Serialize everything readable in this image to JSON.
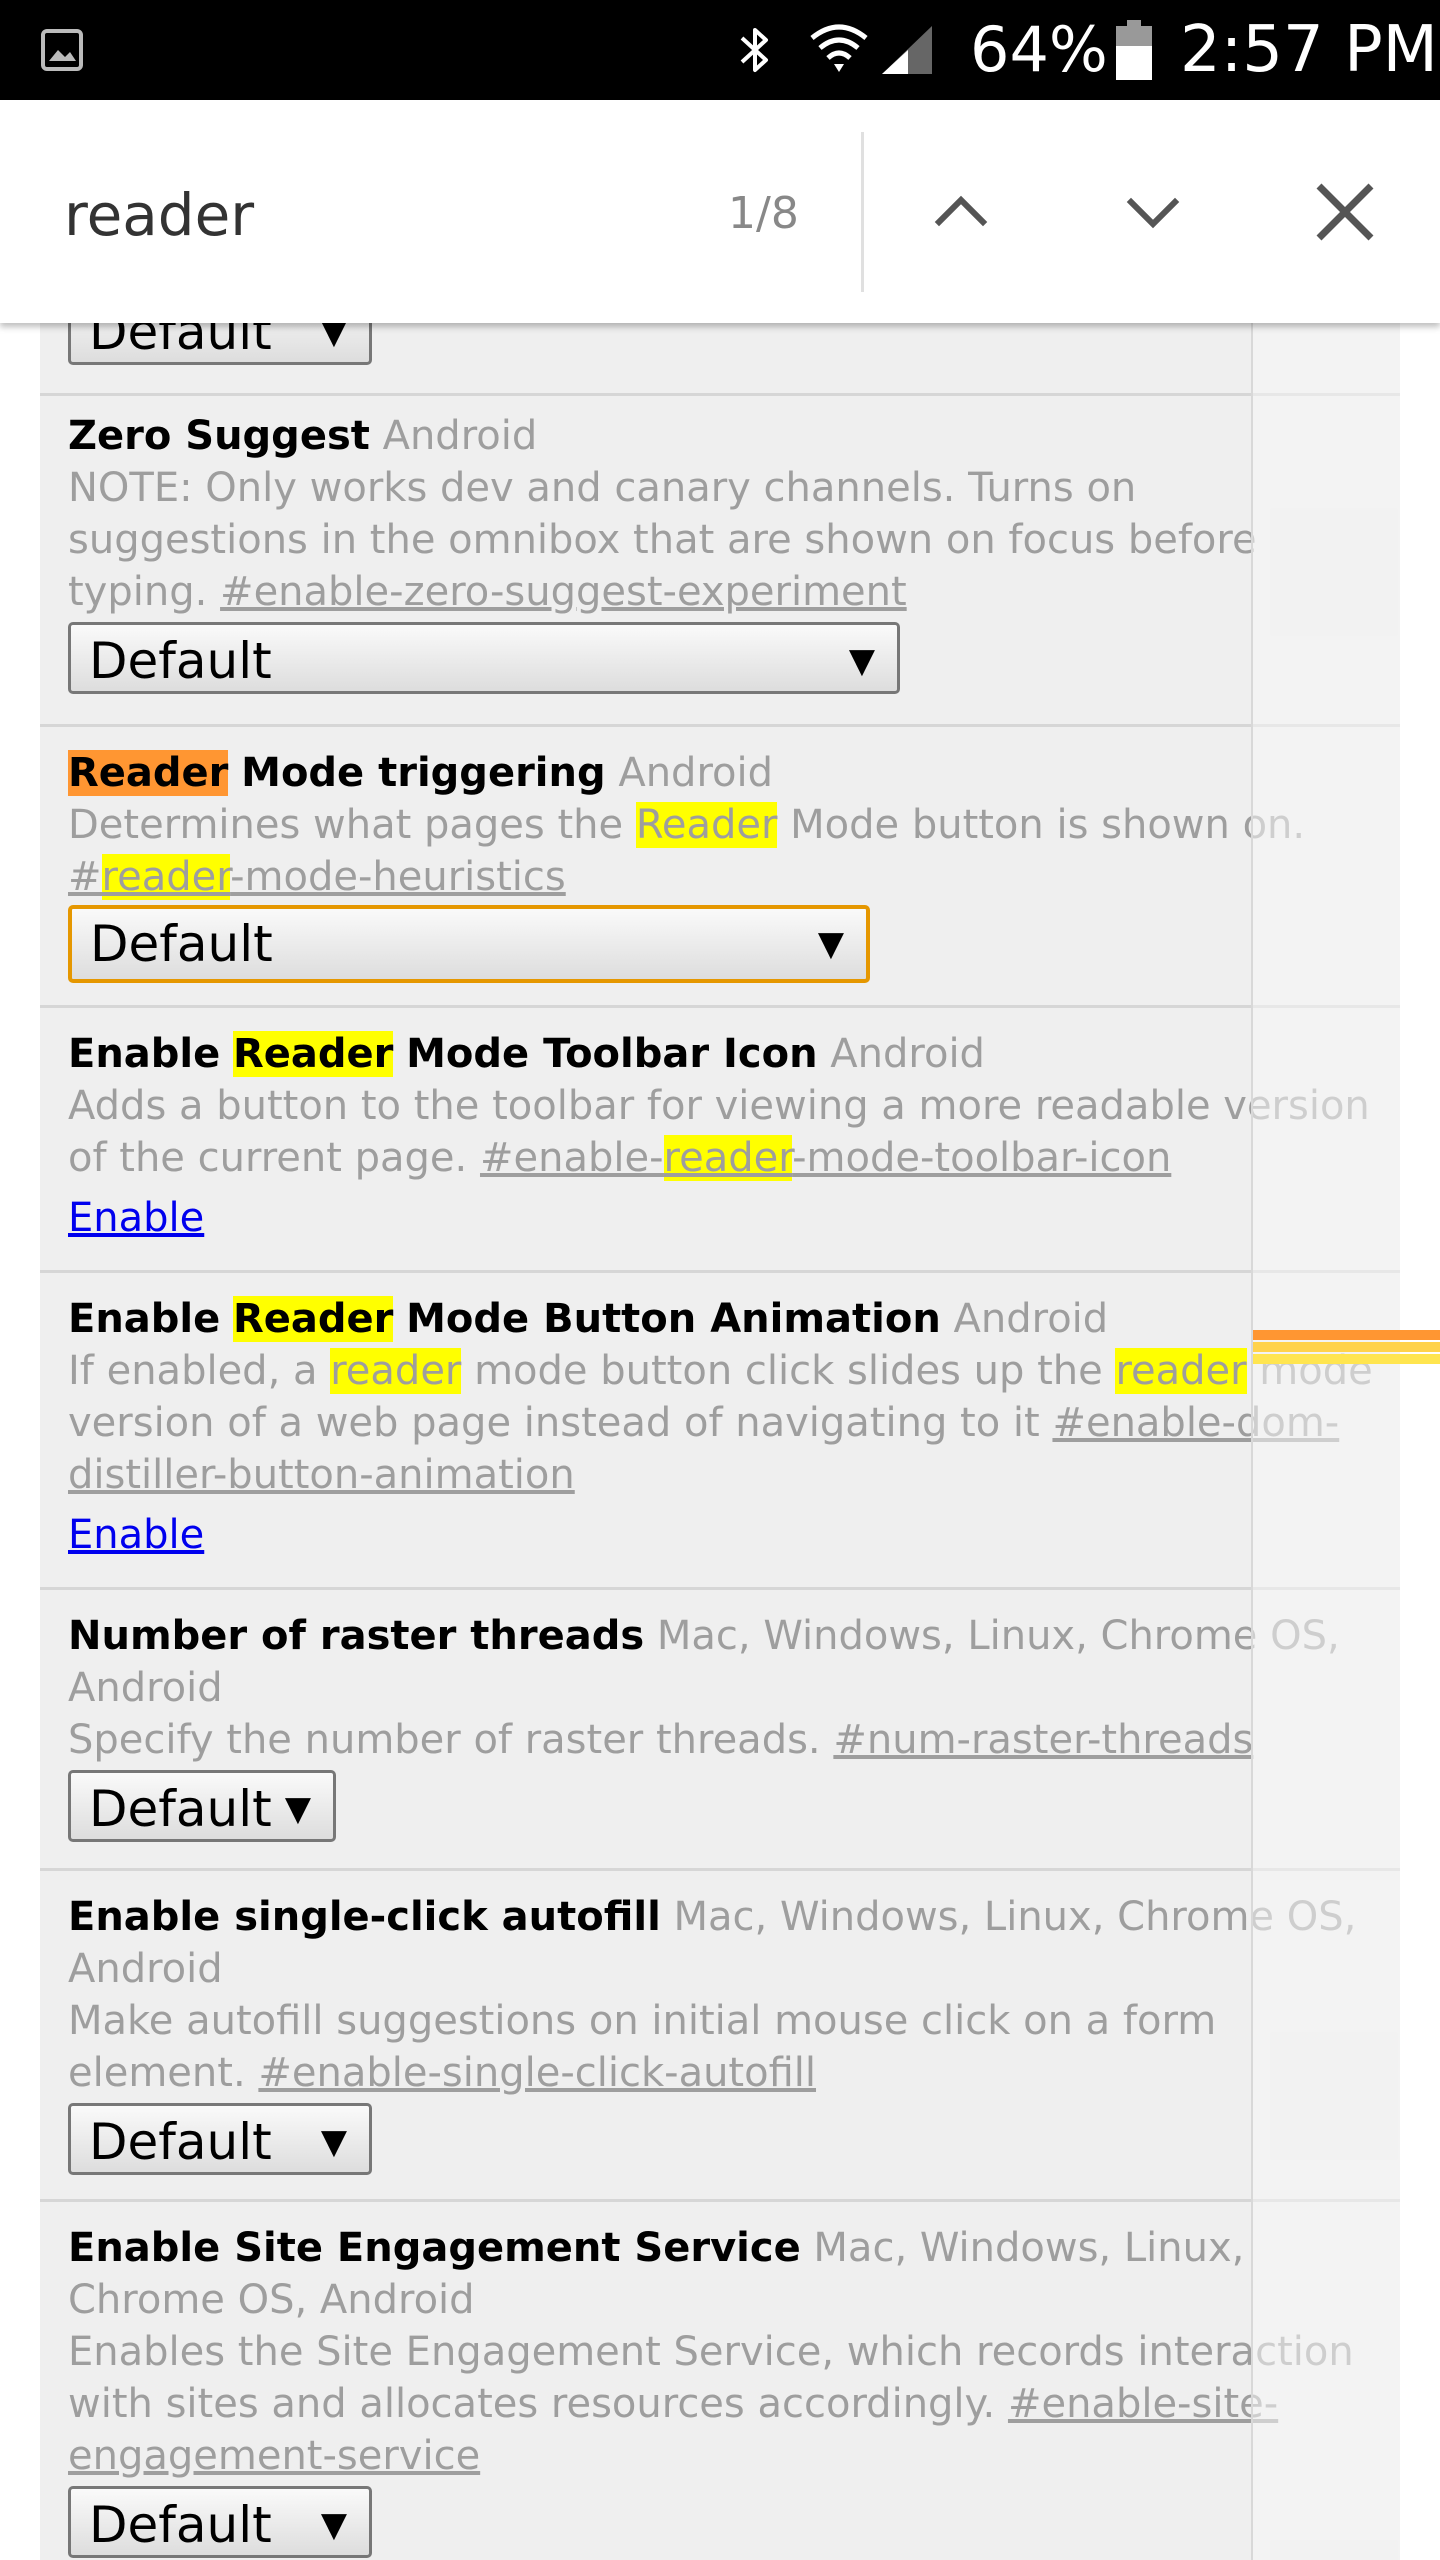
{
  "status_bar": {
    "battery": "64%",
    "time": "2:57 PM",
    "icons": [
      "gallery-icon",
      "bluetooth-icon",
      "wifi-icon",
      "signal-icon",
      "battery-icon"
    ]
  },
  "find_bar": {
    "query": "reader",
    "match_count": "1/8",
    "buttons": [
      "previous-match",
      "next-match",
      "close"
    ]
  },
  "colors": {
    "highlight": "#ffff00",
    "active_highlight": "#ff9632",
    "link": "#0000ee",
    "muted": "#9e9e9e",
    "focus_border": "#e59700"
  },
  "flags": [
    {
      "select_value": "Default"
    },
    {
      "title": "Zero Suggest",
      "platforms": "Android",
      "description": "NOTE: Only works dev and canary channels. Turns on suggestions in the omnibox that are shown on focus before typing.",
      "hashtag": "#enable-zero-suggest-experiment",
      "select_value": "Default"
    },
    {
      "title_highlight": "Reader",
      "title_rest": "Mode triggering",
      "platforms": "Android",
      "description_before": "Determines what pages the",
      "description_highlight": "Reader",
      "description_after": "Mode button is shown on.",
      "hashtag_before": "#",
      "hashtag_highlight": "reader",
      "hashtag_after": "-mode-heuristics",
      "select_value": "Default"
    },
    {
      "title_before": "Enable",
      "title_highlight": "Reader",
      "title_after": "Mode Toolbar Icon",
      "platforms": "Android",
      "description": "Adds a button to the toolbar for viewing a more readable version of the current page.",
      "hashtag_before": "#enable-",
      "hashtag_highlight": "reader",
      "hashtag_after": "-mode-toolbar-icon",
      "action": "Enable"
    },
    {
      "title_before": "Enable",
      "title_highlight": "Reader",
      "title_after": "Mode Button Animation",
      "platforms": "Android",
      "description_1": "If enabled, a",
      "description_hl_1": "reader",
      "description_2": "mode button click slides up the",
      "description_hl_2": "reader",
      "description_3": "mode version of a web page instead of navigating to it",
      "hashtag": "#enable-dom-distiller-button-animation",
      "action": "Enable"
    },
    {
      "title": "Number of raster threads",
      "platforms": "Mac, Windows, Linux, Chrome OS, Android",
      "description": "Specify the number of raster threads.",
      "hashtag": "#num-raster-threads",
      "select_value": "Default"
    },
    {
      "title": "Enable single-click autofill",
      "platforms": "Mac, Windows, Linux, Chrome OS, Android",
      "description": "Make autofill suggestions on initial mouse click on a form element.",
      "hashtag": "#enable-single-click-autofill",
      "select_value": "Default"
    },
    {
      "title": "Enable Site Engagement Service",
      "platforms": "Mac, Windows, Linux, Chrome OS, Android",
      "description": "Enables the Site Engagement Service, which records interaction with sites and allocates resources accordingly.",
      "hashtag": "#enable-site-engagement-service",
      "select_value": "Default"
    }
  ],
  "select_arrow": "▼"
}
